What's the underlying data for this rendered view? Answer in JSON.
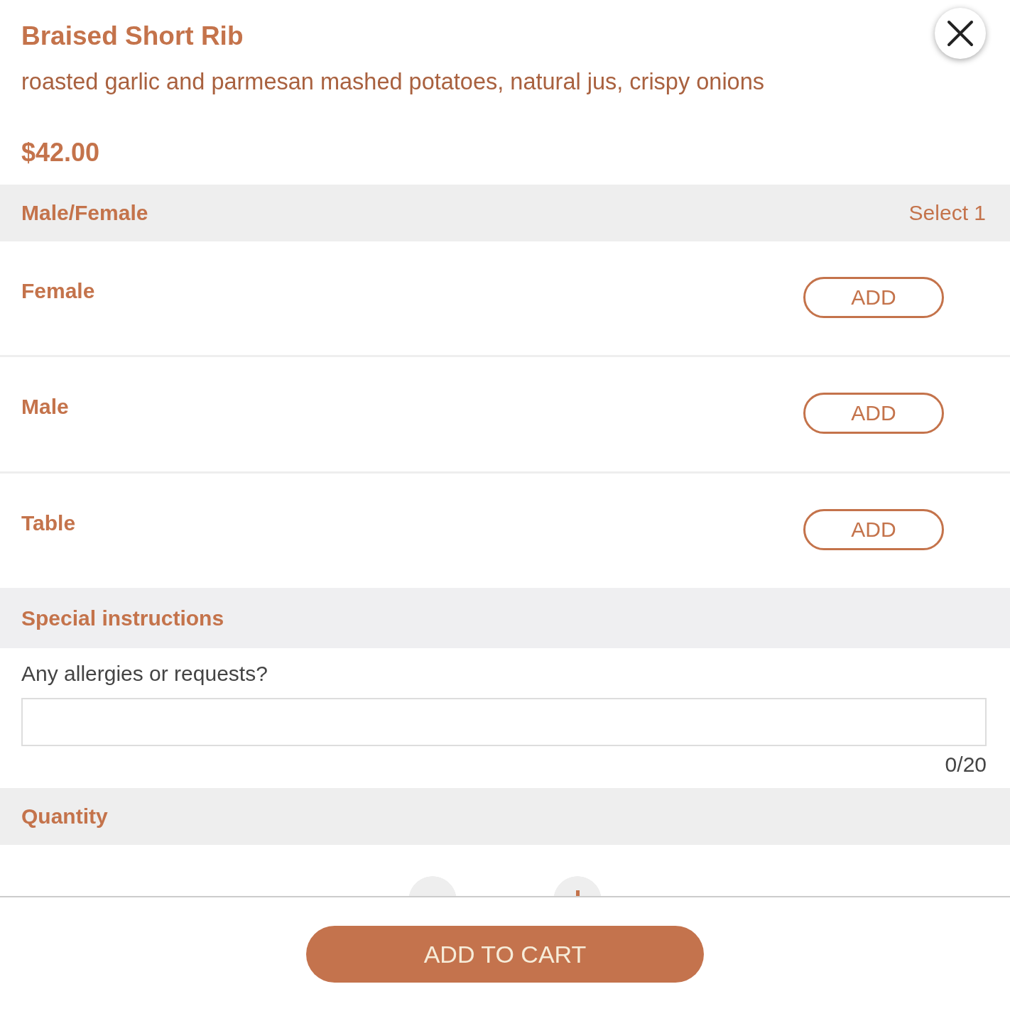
{
  "item": {
    "title": "Braised Short Rib",
    "description": "roasted garlic and parmesan mashed potatoes, natural jus, crispy onions",
    "price": "$42.00"
  },
  "option_groups": [
    {
      "title": "Male/Female",
      "requirement": "Select 1",
      "options": [
        {
          "name": "Female",
          "button": "ADD"
        },
        {
          "name": "Male",
          "button": "ADD"
        },
        {
          "name": "Table",
          "button": "ADD"
        }
      ]
    }
  ],
  "special_instructions": {
    "title": "Special instructions",
    "label": "Any allergies or requests?",
    "counter": "0/20"
  },
  "quantity": {
    "title": "Quantity"
  },
  "footer": {
    "button": "ADD TO CART"
  }
}
